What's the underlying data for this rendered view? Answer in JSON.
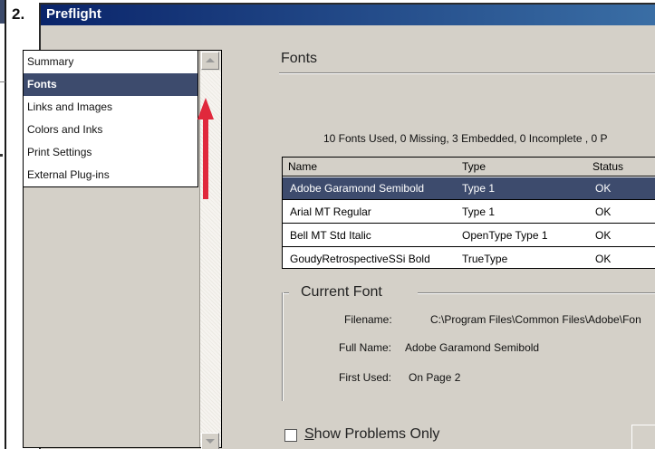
{
  "step_number": "2.",
  "window": {
    "title": "Preflight"
  },
  "sidebar": {
    "items": [
      {
        "label": "Summary",
        "selected": false
      },
      {
        "label": "Fonts",
        "selected": true
      },
      {
        "label": "Links and Images",
        "selected": false
      },
      {
        "label": "Colors and Inks",
        "selected": false
      },
      {
        "label": "Print Settings",
        "selected": false
      },
      {
        "label": "External Plug-ins",
        "selected": false
      }
    ]
  },
  "panel": {
    "title": "Fonts",
    "summary": "10 Fonts Used, 0 Missing, 3 Embedded, 0 Incomplete , 0 P",
    "table": {
      "columns": [
        "Name",
        "Type",
        "Status"
      ],
      "rows": [
        [
          "Adobe Garamond Semibold",
          "Type 1",
          "OK"
        ],
        [
          "Arial MT Regular",
          "Type 1",
          "OK"
        ],
        [
          "Bell MT Std Italic",
          "OpenType Type 1",
          "OK"
        ],
        [
          "GoudyRetrospectiveSSi Bold",
          "TrueType",
          "OK"
        ]
      ],
      "selected_row": 0
    },
    "current_font": {
      "title": "Current Font",
      "filename_label": "Filename:",
      "filename_value": "C:\\Program Files\\Common Files\\Adobe\\Fon",
      "fullname_label": "Full Name:",
      "fullname_value": "Adobe Garamond Semibold",
      "firstused_label": "First Used:",
      "firstused_value": "On Page 2"
    },
    "show_problems": {
      "label": "Show Problems Only",
      "checked": false
    }
  },
  "colors": {
    "selection": "#3d4b6d",
    "dialog_bg": "#d4d0c8",
    "arrow": "#e0283c",
    "titlebar": "#0a246a"
  }
}
